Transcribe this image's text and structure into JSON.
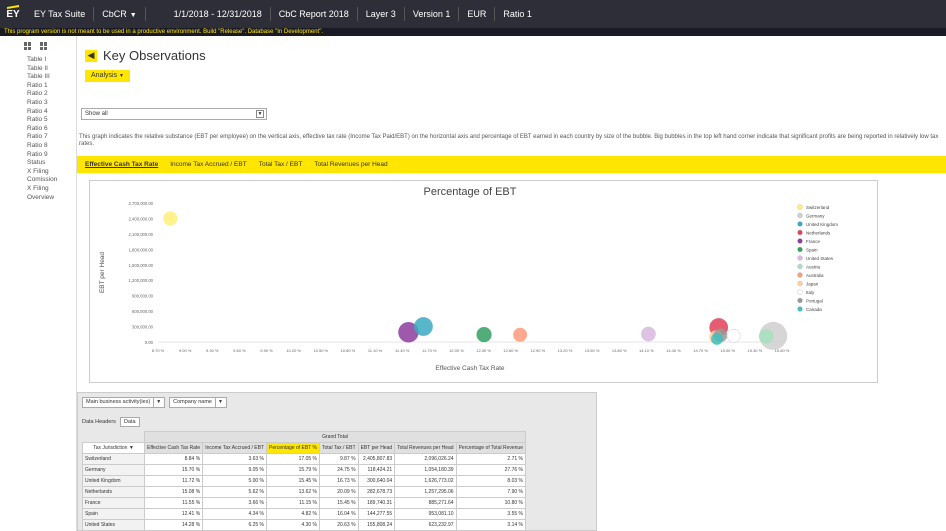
{
  "topbar": {
    "logo": "EY",
    "app_name": "EY Tax Suite",
    "module": "CbCR",
    "period": "1/1/2018 - 12/31/2018",
    "report": "CbC Report 2018",
    "layer": "Layer 3",
    "version": "Version 1",
    "currency": "EUR",
    "ratio": "Ratio 1"
  },
  "warning": "This program version is not meant to be used in a productive environment. Build \"Release\". Database \"In Development\".",
  "sidebar": {
    "items": [
      "Table I",
      "Table II",
      "Table III",
      "Ratio 1",
      "Ratio 2",
      "Ratio 3",
      "Ratio 4",
      "Ratio 5",
      "Ratio 6",
      "Ratio 7",
      "Ratio 8",
      "Ratio 9",
      "Status",
      "X Filing Comission",
      "X Filing Overview"
    ]
  },
  "main": {
    "title": "Key Observations",
    "analysis_label": "Analysis",
    "show_select": "Show all",
    "description": "This graph indicates the relative substance (EBT per employee) on the vertical axis, effective tax rate (Income Tax Paid/EBT) on the horizontal axis and percentage of EBT earned in each country by size of the bubble. Big bubbles in the top left hand corner indicate that significant profits are being reported in relatively low tax rates.",
    "tabs": [
      "Effective Cash Tax Rate",
      "Income Tax Accrued / EBT",
      "Total Tax / EBT",
      "Total Revenues per Head"
    ]
  },
  "chart_data": {
    "type": "scatter",
    "title": "Percentage of EBT",
    "xlabel": "Effective Cash Tax Rate",
    "ylabel": "EBT per Head",
    "xlim": [
      8.7,
      15.8
    ],
    "ylim": [
      0,
      2700000
    ],
    "x_ticks": [
      "8.70 %",
      "9.00 %",
      "9.30 %",
      "9.60 %",
      "9.90 %",
      "10.20 %",
      "10.50 %",
      "10.80 %",
      "11.10 %",
      "11.40 %",
      "11.70 %",
      "12.00 %",
      "12.30 %",
      "12.60 %",
      "12.90 %",
      "13.20 %",
      "13.50 %",
      "13.80 %",
      "14.10 %",
      "14.40 %",
      "14.70 %",
      "15.00 %",
      "15.30 %",
      "15.60 %"
    ],
    "y_ticks": [
      "2,700,000.00",
      "2,400,000.00",
      "2,100,000.00",
      "1,800,000.00",
      "1,500,000.00",
      "1,200,000.00",
      "900,000.00",
      "600,000.00",
      "300,000.00",
      "0.00"
    ],
    "grid": false,
    "legend_position": "right",
    "series": [
      {
        "name": "Switzerland",
        "color": "#ffee77",
        "x": 8.84,
        "y": 2400000,
        "size": 2.71
      },
      {
        "name": "Germany",
        "color": "#cfcfcf",
        "x": 15.7,
        "y": 118000,
        "size": 27.76
      },
      {
        "name": "United Kingdom",
        "color": "#39a9c0",
        "x": 11.72,
        "y": 300000,
        "size": 8.03
      },
      {
        "name": "Netherlands",
        "color": "#e0405a",
        "x": 15.08,
        "y": 282000,
        "size": 7.9
      },
      {
        "name": "France",
        "color": "#8e3c9e",
        "x": 11.55,
        "y": 190000,
        "size": 10.8
      },
      {
        "name": "Spain",
        "color": "#33a060",
        "x": 12.41,
        "y": 144000,
        "size": 3.55
      },
      {
        "name": "United States",
        "color": "#d8b8e0",
        "x": 14.28,
        "y": 155000,
        "size": 3.14
      },
      {
        "name": "Austria",
        "color": "#a8e0c0",
        "x": 15.62,
        "y": 110000,
        "size": 3.0
      },
      {
        "name": "Australia",
        "color": "#ff9a7a",
        "x": 12.82,
        "y": 140000,
        "size": 2.5
      },
      {
        "name": "Japan",
        "color": "#ffd0a0",
        "x": 15.05,
        "y": 95000,
        "size": 2.2
      },
      {
        "name": "Italy",
        "color": "#ffffff",
        "x": 15.25,
        "y": 120000,
        "size": 2.0
      },
      {
        "name": "Portugal",
        "color": "#999999",
        "x": 15.1,
        "y": 130000,
        "size": 2.1
      },
      {
        "name": "Canada",
        "color": "#40c0c0",
        "x": 15.06,
        "y": 60000,
        "size": 1.0
      }
    ]
  },
  "table": {
    "filter1": "Main business activity(ies)",
    "filter2": "Company name",
    "data_headers_label": "Data Headers",
    "data_button": "Data",
    "jurisdiction_label": "Tax Jurisdiction",
    "grand_total": "Grand Total",
    "columns": [
      "Effective Cash Tax Rate",
      "Income Tax Accrued / EBT",
      "Percentage of EBT %",
      "Total Tax / EBT",
      "EBT per Head",
      "Total Revenues per Head",
      "Percentage of Total Revenue"
    ],
    "rows": [
      {
        "name": "Switzerland",
        "vals": [
          "8.84 %",
          "3.63 %",
          "17.05 %",
          "9.87 %",
          "2,405,807.83",
          "2,096,026.24",
          "2.71 %"
        ]
      },
      {
        "name": "Germany",
        "vals": [
          "15.70 %",
          "9.05 %",
          "15.79 %",
          "24.75 %",
          "118,424.21",
          "1,054,180.39",
          "27.76 %"
        ]
      },
      {
        "name": "United Kingdom",
        "vals": [
          "11.72 %",
          "5.00 %",
          "15.45 %",
          "16.73 %",
          "300,640.04",
          "1,626,773.02",
          "8.03 %"
        ]
      },
      {
        "name": "Netherlands",
        "vals": [
          "15.08 %",
          "5.62 %",
          "13.62 %",
          "20.09 %",
          "282,678.73",
          "1,257,295.06",
          "7.90 %"
        ]
      },
      {
        "name": "France",
        "vals": [
          "11.55 %",
          "3.66 %",
          "11.15 %",
          "15.45 %",
          "189,740.31",
          "885,271.64",
          "10.80 %"
        ]
      },
      {
        "name": "Spain",
        "vals": [
          "12.41 %",
          "4.34 %",
          "4.82 %",
          "16.04 %",
          "144,277.55",
          "953,081.10",
          "3.55 %"
        ]
      },
      {
        "name": "United States",
        "vals": [
          "14.28 %",
          "6.25 %",
          "4.30 %",
          "20.63 %",
          "155,808.24",
          "623,232.97",
          "3.14 %"
        ]
      }
    ]
  }
}
